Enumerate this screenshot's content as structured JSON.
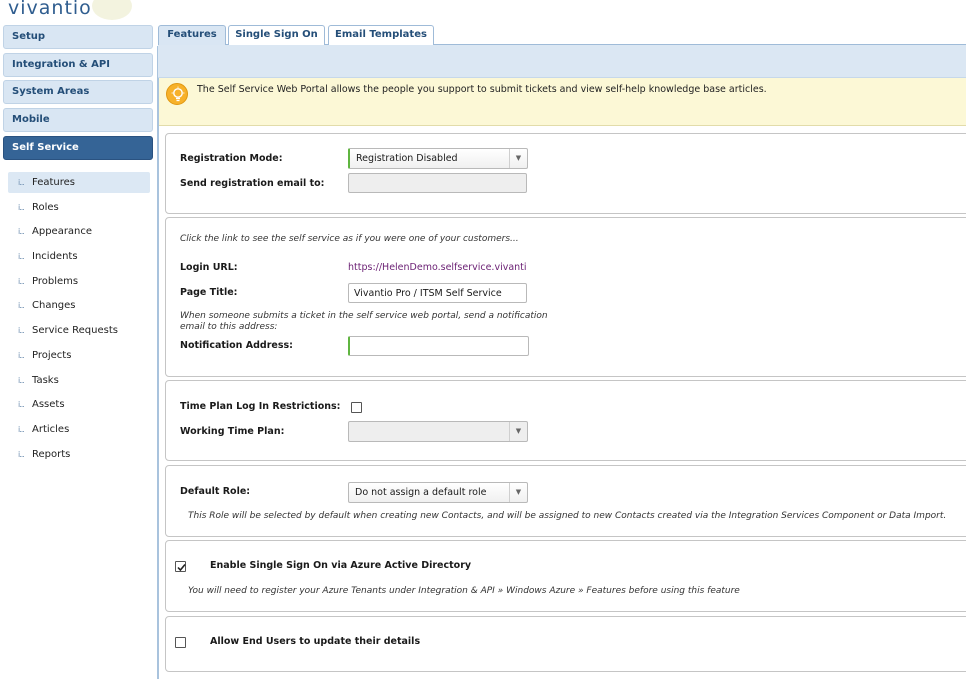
{
  "brand": {
    "logo_text": "vivantio"
  },
  "nav": {
    "groups": [
      "Setup",
      "Integration & API",
      "System Areas",
      "Mobile",
      "Self Service"
    ],
    "sub_items": [
      "Features",
      "Roles",
      "Appearance",
      "Incidents",
      "Problems",
      "Changes",
      "Service Requests",
      "Projects",
      "Tasks",
      "Assets",
      "Articles",
      "Reports"
    ],
    "active_group": "Self Service",
    "active_sub_item": "Features"
  },
  "tabs": [
    "Features",
    "Single Sign On",
    "Email Templates"
  ],
  "info": {
    "text": "The Self Service Web Portal allows the people you support to submit tickets and view self-help knowledge base articles."
  },
  "registration": {
    "mode_label": "Registration Mode:",
    "mode_value": "Registration Disabled",
    "email_label": "Send registration email to:",
    "email_value": ""
  },
  "portal": {
    "hint": "Click the link to see the self service as if you were one of your customers...",
    "login_url_label": "Login URL:",
    "login_url_value": "https://HelenDemo.selfservice.vivanti",
    "page_title_label": "Page Title:",
    "page_title_value": "Vivantio Pro / ITSM Self Service",
    "notification_hint_line1": "When someone submits a ticket in the self service web portal, send a notification",
    "notification_hint_line2": "email to this address:",
    "notification_label": "Notification Address:",
    "notification_value": ""
  },
  "timeplan": {
    "restrictions_label": "Time Plan Log In Restrictions:",
    "restrictions_checked": false,
    "working_label": "Working Time Plan:",
    "working_value": ""
  },
  "role": {
    "label": "Default Role:",
    "value": "Do not assign a default role",
    "hint": "This Role will be selected by default when creating new Contacts, and will be assigned to new Contacts created via the Integration Services Component or Data Import."
  },
  "sso": {
    "label": "Enable Single Sign On via Azure Active Directory",
    "checked": true,
    "hint": "You will need to register your Azure Tenants under Integration & API » Windows Azure » Features before using this feature"
  },
  "enduser": {
    "label": "Allow End Users to update their details",
    "checked": false
  }
}
